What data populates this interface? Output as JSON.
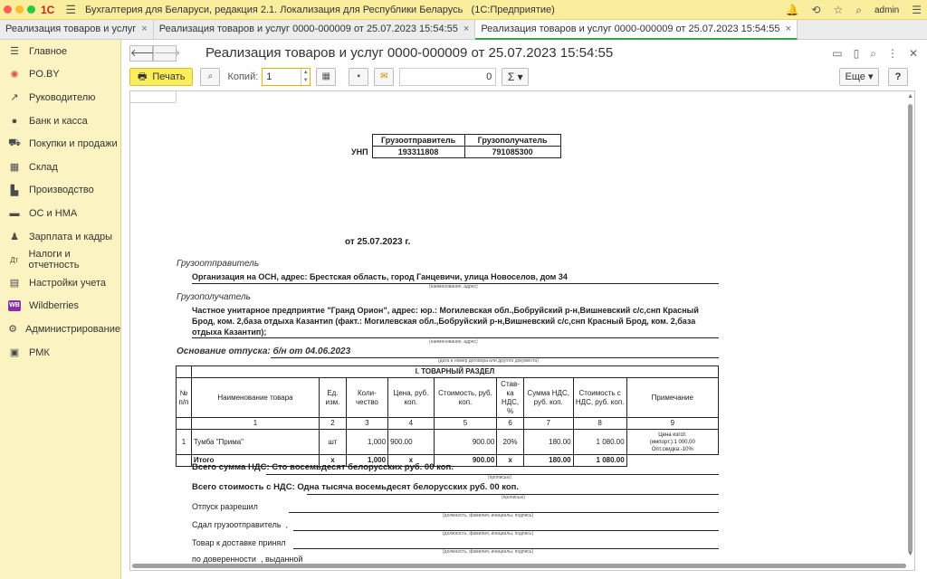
{
  "app": {
    "logo": "1С",
    "title": "Бухгалтерия для Беларуси, редакция 2.1. Локализация для Республики Беларусь",
    "subtitle": "(1С:Предприятие)",
    "user": "admin"
  },
  "tabs": [
    {
      "label": "Реализация товаров и услуг"
    },
    {
      "label": "Реализация товаров и услуг 0000-000009 от 25.07.2023 15:54:55"
    },
    {
      "label": "Реализация товаров и услуг 0000-000009 от 25.07.2023 15:54:55"
    }
  ],
  "sidebar": {
    "items": [
      {
        "label": "Главное",
        "icon": "menu-icon"
      },
      {
        "label": "PO.BY",
        "icon": "sun-icon"
      },
      {
        "label": "Руководителю",
        "icon": "trend-icon"
      },
      {
        "label": "Банк и касса",
        "icon": "coin-icon"
      },
      {
        "label": "Покупки и продажи",
        "icon": "cart-icon"
      },
      {
        "label": "Склад",
        "icon": "warehouse-icon"
      },
      {
        "label": "Производство",
        "icon": "factory-icon"
      },
      {
        "label": "ОС и НМА",
        "icon": "truck-icon"
      },
      {
        "label": "Зарплата и кадры",
        "icon": "person-icon"
      },
      {
        "label": "Налоги и отчетность",
        "icon": "tax-icon"
      },
      {
        "label": "Настройки учета",
        "icon": "document-icon"
      },
      {
        "label": "Wildberries",
        "icon": "wb-icon",
        "badge": "WB"
      },
      {
        "label": "Администрирование",
        "icon": "gear-icon"
      },
      {
        "label": "РМК",
        "icon": "register-icon"
      }
    ]
  },
  "form": {
    "title": "Реализация товаров и услуг 0000-000009 от 25.07.2023 15:54:55",
    "print_label": "Печать",
    "copies_label": "Копий:",
    "copies_value": "1",
    "num_value": "0",
    "sigma": "Σ",
    "more_label": "Еще",
    "help_label": "?"
  },
  "doc": {
    "hdr_sender": "Грузоотправитель",
    "hdr_receiver": "Грузополучатель",
    "unp_label": "УНП",
    "unp_sender": "193311808",
    "unp_receiver": "791085300",
    "date_line": "от 25.07.2023 г.",
    "sender_label": "Грузоотправитель",
    "sender_text": "Организация на ОСН, адрес: Брестская область, город Ганцевичи, улица Новоселов, дом 34",
    "naimenovanie_adres": "(наименование, адрес)",
    "receiver_label": "Грузополучатель",
    "receiver_text_1": "Частное унитарное предприятие \"Гранд Орион\", адрес: юр.: Могилевская обл.,Бобруйский р-н,Вишневский с/с,снп Красный",
    "receiver_text_2": "Брод, ком. 2,база отдыха Казантип (факт.: Могилевская обл.,Бобруйский р-н,Вишневский с/с,снп Красный Брод, ком. 2,база",
    "receiver_text_3": "отдыха Казантип);",
    "osnovanie": "Основание отпуска: б/н от 04.06.2023",
    "data_nomer": "(дата и номер договора или другого документа)",
    "goods_section": "I. ТОВАРНЫЙ РАЗДЕЛ",
    "cols": {
      "num": "№ п/п",
      "name": "Наименование товара",
      "unit": "Ед. изм.",
      "qty": "Коли- чество",
      "price": "Цена, руб. коп.",
      "cost": "Стоимость, руб. коп.",
      "vat_rate": "Став- ка НДС, %",
      "vat_sum": "Сумма НДС, руб. коп.",
      "total": "Стоимость с НДС, руб. коп.",
      "note": "Примечание"
    },
    "col_nums": [
      "1",
      "2",
      "3",
      "4",
      "5",
      "6",
      "7",
      "8",
      "9"
    ],
    "row": {
      "num": "1",
      "name": "Тумба \"Прима\"",
      "unit": "шт",
      "qty": "1,000",
      "price": "900.00",
      "cost": "900.00",
      "vat_rate": "20%",
      "vat_sum": "180.00",
      "total": "1 080.00",
      "note_1": "Цена изгот.",
      "note_2": "(импорт.):1 000,00",
      "note_3": "Опт.скидка:-10%"
    },
    "total_row": {
      "label": "Итого",
      "unit": "х",
      "qty": "1,000",
      "price": "х",
      "cost": "900.00",
      "vat_rate": "х",
      "vat_sum": "180.00",
      "total": "1 080.00"
    },
    "vat_sum_line": "Всего сумма НДС: Сто восемьдесят белорусских руб. 00 коп.",
    "propisyu": "(прописью)",
    "total_line": "Всего стоимость с НДС: Одна тысяча восемьдесят белорусских руб. 00 коп.",
    "otpusk": "Отпуск разрешил",
    "sdal": "Сдал грузоотправитель",
    "comma": ",",
    "dolzhnost": "(должность, фамилия, инициалы, подпись)",
    "tovar_prinyal": "Товар к доставке принял",
    "po_doverennosti": "по доверенности",
    "vydannoy": ", выданной"
  }
}
